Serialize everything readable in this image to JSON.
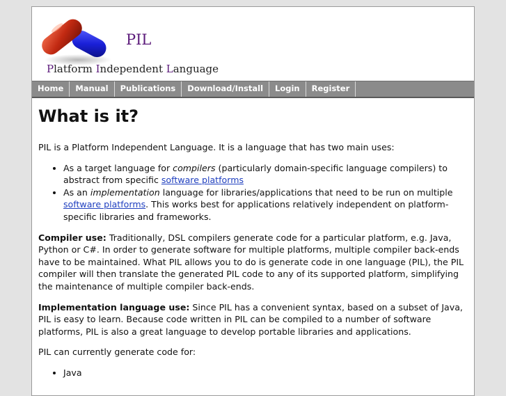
{
  "header": {
    "logo_short": "PIL",
    "logo_long": {
      "p": "P",
      "latform": "latform ",
      "i": "I",
      "ndependent": "ndependent ",
      "l": "L",
      "anguage": "anguage"
    }
  },
  "nav": [
    "Home",
    "Manual",
    "Publications",
    "Download/Install",
    "Login",
    "Register"
  ],
  "content": {
    "title": "What is it?",
    "intro": "PIL is a Platform Independent Language. It is a language that has two main uses:",
    "uses": [
      {
        "pre": "As a target language for ",
        "em": "compilers",
        "mid": " (particularly domain-specific language compilers) to abstract from specific ",
        "link": "software platforms",
        "post": ""
      },
      {
        "pre": "As an ",
        "em": "implementation",
        "mid": " language for libraries/applications that need to be run on multiple ",
        "link": "software platforms",
        "post": ". This works best for applications relatively independent on platform-specific libraries and frameworks."
      }
    ],
    "compiler_label": "Compiler use:",
    "compiler_text": " Traditionally, DSL compilers generate code for a particular platform, e.g. Java, Python or C#. In order to generate software for multiple platforms, multiple compiler back-ends have to be maintained. What PIL allows you to do is generate code in one language (PIL), the PIL compiler will then translate the generated PIL code to any of its supported platform, simplifying the maintenance of multiple compiler back-ends.",
    "impl_label": "Implementation language use:",
    "impl_text": " Since PIL has a convenient syntax, based on a subset of Java, PIL is easy to learn. Because code written in PIL can be compiled to a number of software platforms, PIL is also a great language to develop portable libraries and applications.",
    "platforms_intro": "PIL can currently generate code for:",
    "platforms": [
      "Java"
    ]
  }
}
